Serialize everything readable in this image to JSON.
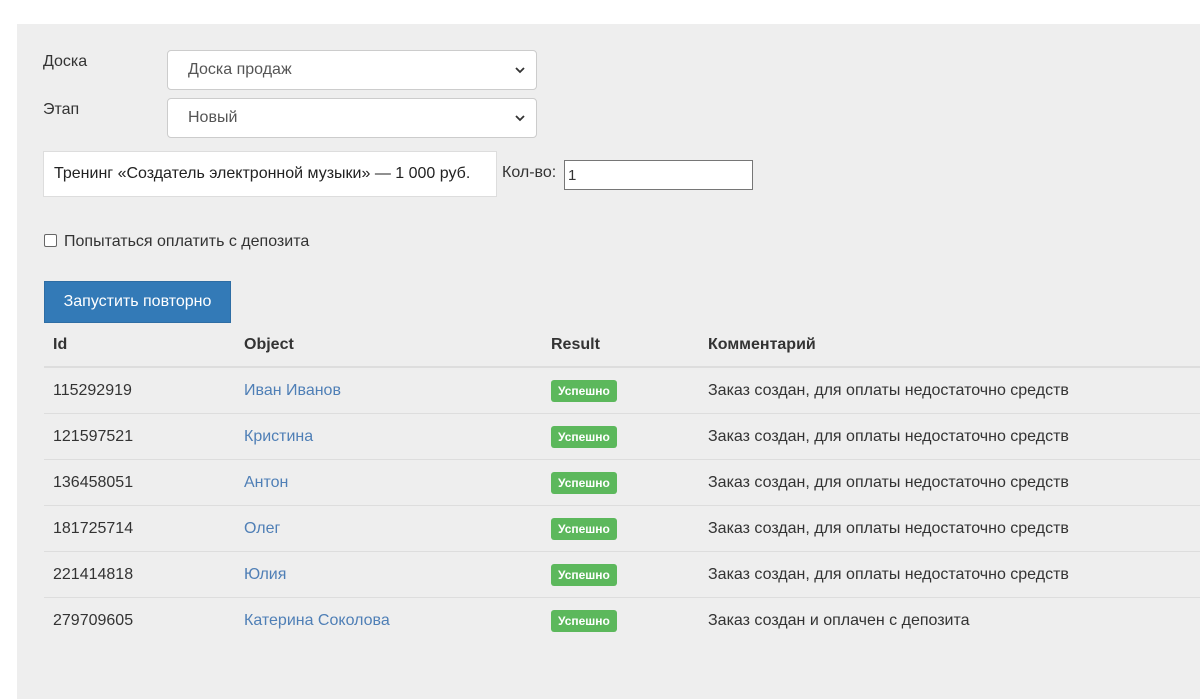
{
  "form": {
    "board_label": "Доска",
    "board_value": "Доска продаж",
    "stage_label": "Этап",
    "stage_value": "Новый",
    "product": "Тренинг «Создатель электронной музыки» — 1 000 руб.",
    "qty_label": "Кол-во:",
    "qty_value": "1",
    "deposit_label": "Попытаться оплатить с депозита",
    "deposit_checked": false,
    "rerun_button": "Запустить повторно"
  },
  "table": {
    "headers": [
      "Id",
      "Object",
      "Result",
      "Комментарий"
    ],
    "rows": [
      {
        "id": "115292919",
        "object": "Иван Иванов",
        "result": "Успешно",
        "comment": "Заказ создан, для оплаты недостаточно средств"
      },
      {
        "id": "121597521",
        "object": "Кристина",
        "result": "Успешно",
        "comment": "Заказ создан, для оплаты недостаточно средств"
      },
      {
        "id": "136458051",
        "object": "Антон",
        "result": "Успешно",
        "comment": "Заказ создан, для оплаты недостаточно средств"
      },
      {
        "id": "181725714",
        "object": "Олег",
        "result": "Успешно",
        "comment": "Заказ создан, для оплаты недостаточно средств"
      },
      {
        "id": "221414818",
        "object": "Юлия",
        "result": "Успешно",
        "comment": "Заказ создан, для оплаты недостаточно средств"
      },
      {
        "id": "279709605",
        "object": "Катерина Соколова",
        "result": "Успешно",
        "comment": "Заказ создан и оплачен с депозита"
      }
    ]
  },
  "colors": {
    "primary_button": "#337ab7",
    "success_badge": "#5cb85c",
    "link": "#4f7fb6",
    "panel_bg": "#eeeeee"
  },
  "icons": {
    "select_arrow": "chevron-down-icon"
  }
}
